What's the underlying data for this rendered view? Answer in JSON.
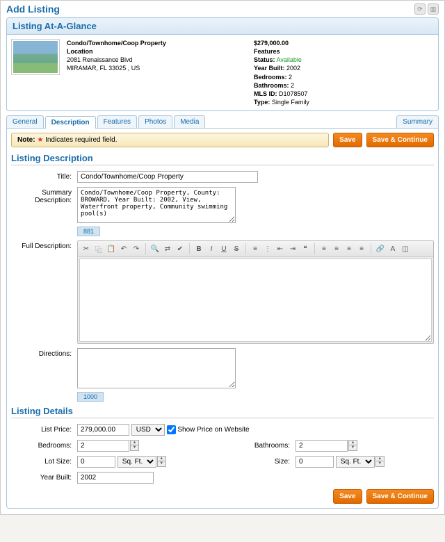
{
  "page_title": "Add Listing",
  "glance": {
    "header": "Listing At-A-Glance",
    "property_title": "Condo/Townhome/Coop Property",
    "location_label": "Location",
    "address1": "2081 Renaissance Blvd",
    "address2": "MIRAMAR, FL 33025 , US",
    "price": "$279,000.00",
    "features_label": "Features",
    "status_label": "Status:",
    "status_value": "Available",
    "year_built_label": "Year Built:",
    "year_built_value": "2002",
    "bedrooms_label": "Bedrooms:",
    "bedrooms_value": "2",
    "bathrooms_label": "Bathrooms:",
    "bathrooms_value": "2",
    "mls_label": "MLS ID:",
    "mls_value": "D1078507",
    "type_label": "Type:",
    "type_value": "Single Family"
  },
  "tabs": {
    "general": "General",
    "description": "Description",
    "features": "Features",
    "photos": "Photos",
    "media": "Media",
    "summary": "Summary"
  },
  "note": {
    "prefix": "Note:",
    "text": "Indicates required field."
  },
  "buttons": {
    "save": "Save",
    "save_continue": "Save & Continue"
  },
  "description_section": {
    "header": "Listing Description",
    "title_label": "Title:",
    "title_value": "Condo/Townhome/Coop Property",
    "summary_label": "Summary Description:",
    "summary_value": "Condo/Townhome/Coop Property, County: BROWARD, Year Built: 2002, View, Waterfront property, Community swimming pool(s)",
    "summary_counter": "881",
    "full_label": "Full Description:",
    "directions_label": "Directions:",
    "directions_value": "",
    "directions_counter": "1000"
  },
  "details_section": {
    "header": "Listing Details",
    "list_price_label": "List Price:",
    "list_price_value": "279,000.00",
    "currency": "USD",
    "show_price_label": "Show Price on Website",
    "bedrooms_label": "Bedrooms:",
    "bedrooms_value": "2",
    "bathrooms_label": "Bathrooms:",
    "bathrooms_value": "2",
    "lot_size_label": "Lot Size:",
    "lot_size_value": "0",
    "lot_size_unit": "Sq. Ft.",
    "size_label": "Size:",
    "size_value": "0",
    "size_unit": "Sq. Ft.",
    "year_built_label": "Year Built:",
    "year_built_value": "2002"
  }
}
